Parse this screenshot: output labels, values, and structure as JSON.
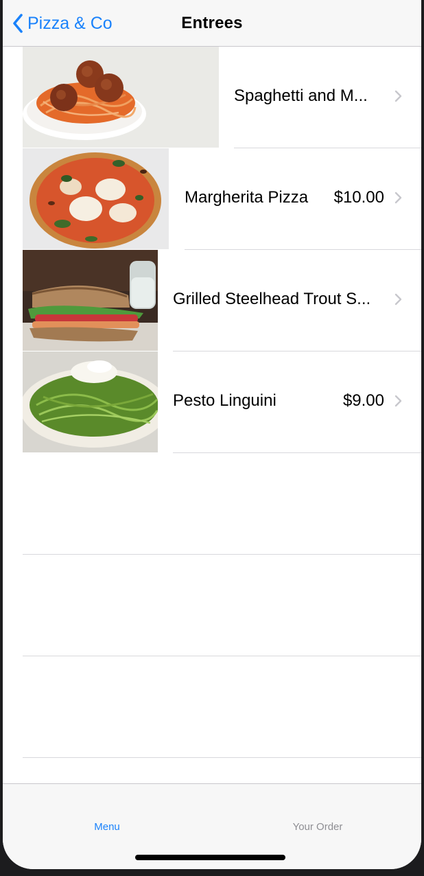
{
  "navbar": {
    "back_label": "Pizza & Co",
    "title": "Entrees"
  },
  "menu_items": [
    {
      "name": "Spaghetti and M...",
      "price": ""
    },
    {
      "name": "Margherita Pizza",
      "price": "$10.00"
    },
    {
      "name": "Grilled Steelhead Trout S...",
      "price": ""
    },
    {
      "name": "Pesto Linguini",
      "price": "$9.00"
    }
  ],
  "tabbar": {
    "menu_label": "Menu",
    "order_label": "Your Order"
  },
  "colors": {
    "accent": "#1a82fb",
    "inactive_tab": "#8e8e93",
    "separator": "#d8d8dc"
  },
  "icons": [
    "chevron-left-icon",
    "chevron-right-icon"
  ]
}
